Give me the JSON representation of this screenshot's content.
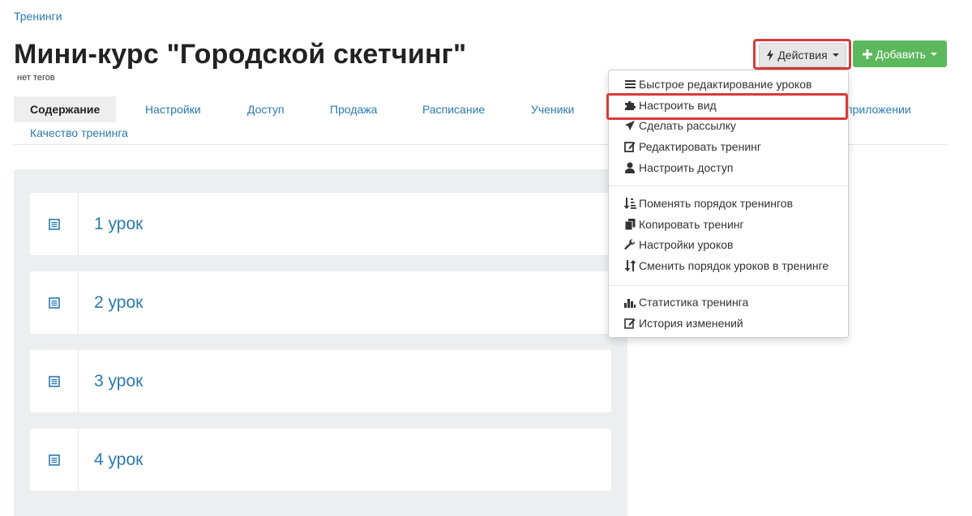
{
  "breadcrumb": "Тренинги",
  "page_title": "Мини-курс \"Городской скетчинг\"",
  "tags": "нет тегов",
  "buttons": {
    "actions": "Действия",
    "add": "Добавить"
  },
  "tabs": [
    "Содержание",
    "Настройки",
    "Доступ",
    "Продажа",
    "Расписание",
    "Ученики",
    "приложении",
    "Качество тренинга"
  ],
  "lessons": [
    "1 урок",
    "2 урок",
    "3 урок",
    "4 урок"
  ],
  "menu": {
    "group1": [
      {
        "label": "Быстрое редактирование уроков",
        "icon": "list-icon"
      },
      {
        "label": "Настроить вид",
        "icon": "puzzle-icon"
      },
      {
        "label": "Сделать рассылку",
        "icon": "send-icon"
      },
      {
        "label": "Редактировать тренинг",
        "icon": "edit-icon"
      },
      {
        "label": "Настроить доступ",
        "icon": "user-icon"
      }
    ],
    "group2": [
      {
        "label": "Поменять порядок тренингов",
        "icon": "sort-icon"
      },
      {
        "label": "Копировать тренинг",
        "icon": "copy-icon"
      },
      {
        "label": "Настройки уроков",
        "icon": "wrench-icon"
      },
      {
        "label": "Сменить порядок уроков в тренинге",
        "icon": "sort-arrows-icon"
      }
    ],
    "group3": [
      {
        "label": "Статистика тренинга",
        "icon": "bar-chart-icon"
      },
      {
        "label": "История изменений",
        "icon": "history-icon"
      }
    ]
  },
  "colors": {
    "link": "#2a7ab0",
    "green": "#5cb85c",
    "highlight": "#d83a3a"
  }
}
